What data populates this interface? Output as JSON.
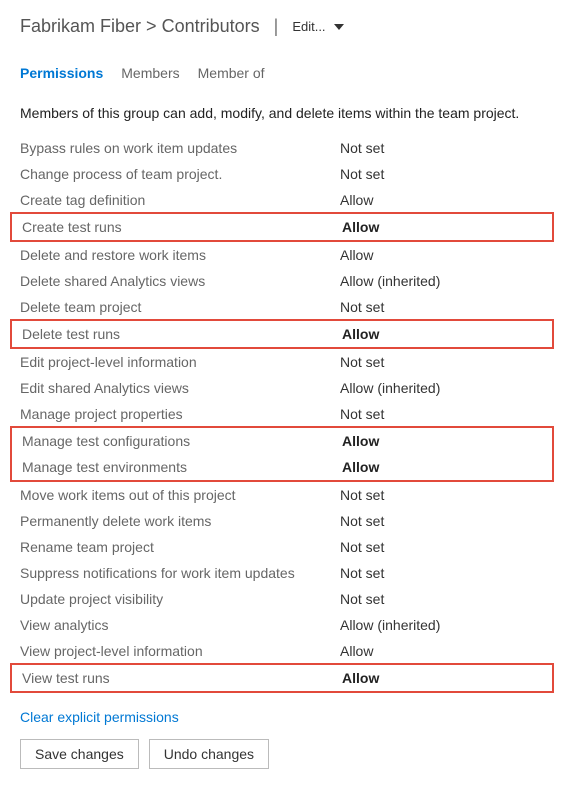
{
  "breadcrumb": {
    "project": "Fabrikam Fiber",
    "sep": ">",
    "group": "Contributors"
  },
  "editLabel": "Edit...",
  "tabs": {
    "permissions": "Permissions",
    "members": "Members",
    "memberOf": "Member of"
  },
  "description": "Members of this group can add, modify, and delete items within the team project.",
  "permissions": [
    {
      "label": "Bypass rules on work item updates",
      "value": "Not set",
      "bold": false,
      "hl": false
    },
    {
      "label": "Change process of team project.",
      "value": "Not set",
      "bold": false,
      "hl": false
    },
    {
      "label": "Create tag definition",
      "value": "Allow",
      "bold": false,
      "hl": false
    },
    {
      "label": "Create test runs",
      "value": "Allow",
      "bold": true,
      "hl": true
    },
    {
      "label": "Delete and restore work items",
      "value": "Allow",
      "bold": false,
      "hl": false
    },
    {
      "label": "Delete shared Analytics views",
      "value": "Allow (inherited)",
      "bold": false,
      "hl": false
    },
    {
      "label": "Delete team project",
      "value": "Not set",
      "bold": false,
      "hl": false
    },
    {
      "label": "Delete test runs",
      "value": "Allow",
      "bold": true,
      "hl": true
    },
    {
      "label": "Edit project-level information",
      "value": "Not set",
      "bold": false,
      "hl": false
    },
    {
      "label": "Edit shared Analytics views",
      "value": "Allow (inherited)",
      "bold": false,
      "hl": false
    },
    {
      "label": "Manage project properties",
      "value": "Not set",
      "bold": false,
      "hl": false
    },
    {
      "label": "Manage test configurations",
      "value": "Allow",
      "bold": true,
      "hl": true
    },
    {
      "label": "Manage test environments",
      "value": "Allow",
      "bold": true,
      "hl": true
    },
    {
      "label": "Move work items out of this project",
      "value": "Not set",
      "bold": false,
      "hl": false
    },
    {
      "label": "Permanently delete work items",
      "value": "Not set",
      "bold": false,
      "hl": false
    },
    {
      "label": "Rename team project",
      "value": "Not set",
      "bold": false,
      "hl": false
    },
    {
      "label": "Suppress notifications for work item updates",
      "value": "Not set",
      "bold": false,
      "hl": false
    },
    {
      "label": "Update project visibility",
      "value": "Not set",
      "bold": false,
      "hl": false
    },
    {
      "label": "View analytics",
      "value": "Allow (inherited)",
      "bold": false,
      "hl": false
    },
    {
      "label": "View project-level information",
      "value": "Allow",
      "bold": false,
      "hl": false
    },
    {
      "label": "View test runs",
      "value": "Allow",
      "bold": true,
      "hl": true
    }
  ],
  "clearLink": "Clear explicit permissions",
  "buttons": {
    "save": "Save changes",
    "undo": "Undo changes"
  }
}
